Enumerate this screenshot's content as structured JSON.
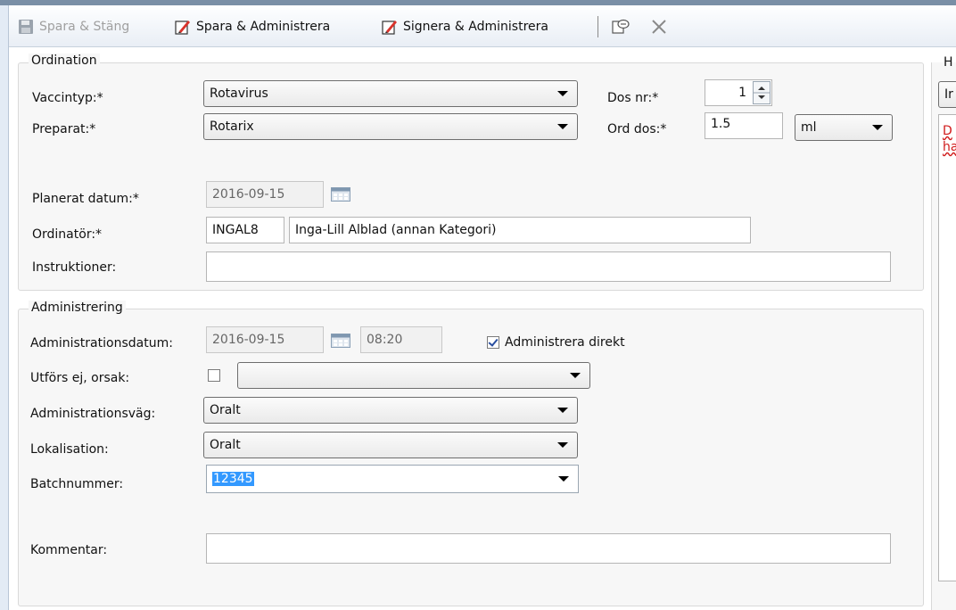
{
  "toolbar": {
    "save_close_label": "Spara & Stäng",
    "save_admin_label": "Spara & Administrera",
    "sign_admin_label": "Signera & Administrera"
  },
  "ordination": {
    "title": "Ordination",
    "vaccintyp_label": "Vaccintyp:*",
    "vaccintyp_value": "Rotavirus",
    "preparat_label": "Preparat:*",
    "preparat_value": "Rotarix",
    "dosnr_label": "Dos nr:*",
    "dosnr_value": "1",
    "orddos_label": "Ord dos:*",
    "orddos_value": "1.5",
    "unit_value": "ml",
    "planerat_label": "Planerat datum:*",
    "planerat_value": "2016-09-15",
    "ordinator_label": "Ordinatör:*",
    "ordinator_code": "INGAL8",
    "ordinator_name": "Inga-Lill Alblad (annan Kategori)",
    "instruktioner_label": "Instruktioner:",
    "instruktioner_value": ""
  },
  "administrering": {
    "title": "Administrering",
    "datum_label": "Administrationsdatum:",
    "datum_value": "2016-09-15",
    "time_value": "08:20",
    "direkt_label": "Administrera direkt",
    "direkt_checked": true,
    "utfors_label": "Utförs ej, orsak:",
    "utfors_checked": false,
    "utfors_value": "",
    "vag_label": "Administrationsväg:",
    "vag_value": "Oralt",
    "lokalisation_label": "Lokalisation:",
    "lokalisation_value": "Oralt",
    "batch_label": "Batchnummer:",
    "batch_value": "12345",
    "kommentar_label": "Kommentar:",
    "kommentar_value": ""
  },
  "right_panel": {
    "header_partial": "H",
    "combo_partial": "Ir",
    "text_partial_1": "D",
    "text_partial_2": "ha"
  }
}
